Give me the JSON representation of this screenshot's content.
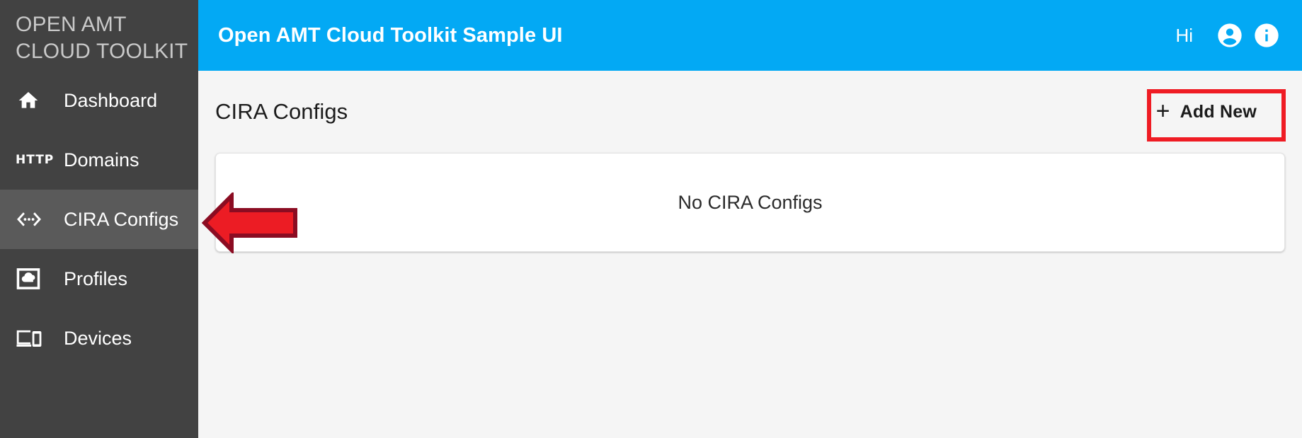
{
  "brand": {
    "line1": "OPEN AMT",
    "line2": "CLOUD TOOLKIT"
  },
  "colors": {
    "sidebar_bg": "#424242",
    "sidebar_active_bg": "#5a5a5a",
    "topbar_bg": "#03a9f4",
    "page_bg": "#f5f5f5",
    "card_bg": "#ffffff",
    "annotation_red": "#ef1c24",
    "annotation_arrow_fill": "#ec1c24",
    "annotation_arrow_stroke": "#8b0c22",
    "text_dark": "#1c1c1c",
    "text_light": "#ffffff"
  },
  "sidebar": {
    "items": [
      {
        "id": "dashboard",
        "label": "Dashboard",
        "icon": "home-icon",
        "active": false
      },
      {
        "id": "domains",
        "label": "Domains",
        "icon": "http-icon",
        "active": false
      },
      {
        "id": "cira-configs",
        "label": "CIRA Configs",
        "icon": "developer-mode-icon",
        "active": true
      },
      {
        "id": "profiles",
        "label": "Profiles",
        "icon": "cloud-in-frame-icon",
        "active": false
      },
      {
        "id": "devices",
        "label": "Devices",
        "icon": "devices-icon",
        "active": false
      }
    ]
  },
  "topbar": {
    "title": "Open AMT Cloud Toolkit Sample UI",
    "greeting": "Hi",
    "account_icon": "account-circle-icon",
    "info_icon": "info-circle-icon"
  },
  "page": {
    "title": "CIRA Configs",
    "add_new_label": "Add New",
    "add_new_plus": "+",
    "empty_message": "No CIRA Configs"
  },
  "annotations": {
    "highlight_box_target": "Add New",
    "arrow_target": "CIRA Configs"
  }
}
